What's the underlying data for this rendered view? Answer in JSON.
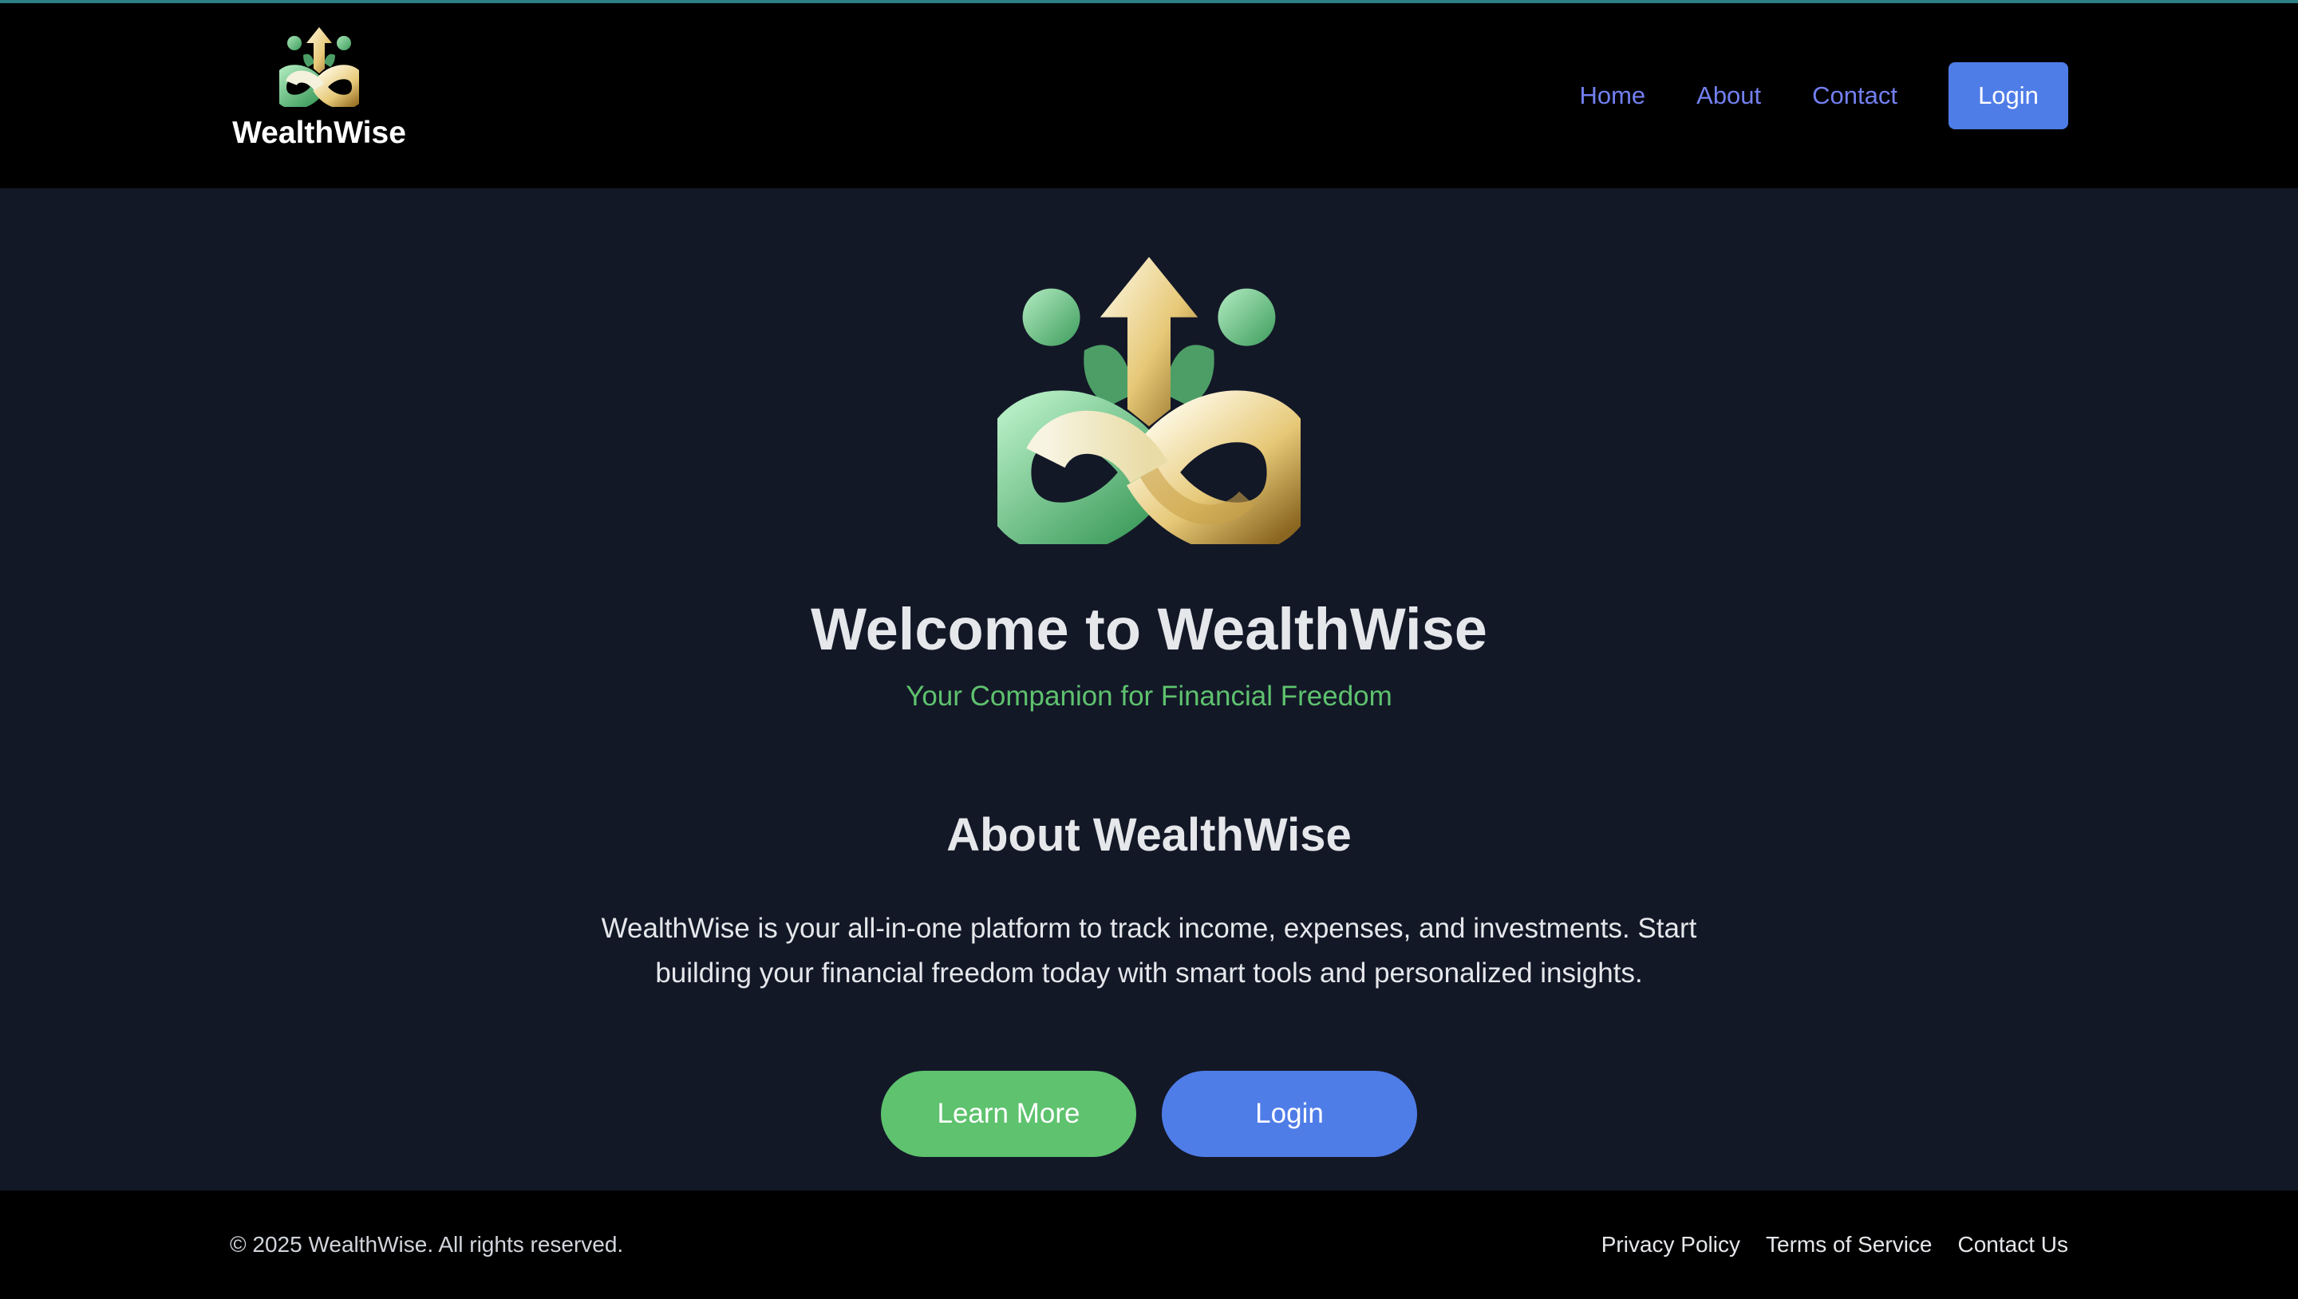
{
  "header": {
    "brand_name": "WealthWise",
    "nav": {
      "home": "Home",
      "about": "About",
      "contact": "Contact",
      "login": "Login"
    }
  },
  "hero": {
    "title": "Welcome to WealthWise",
    "subtitle": "Your Companion for Financial Freedom"
  },
  "about": {
    "title": "About WealthWise",
    "text": "WealthWise is your all-in-one platform to track income, expenses, and investments. Start building your financial freedom today with smart tools and personalized insights."
  },
  "cta": {
    "learn_more": "Learn More",
    "login": "Login"
  },
  "footer": {
    "copyright": "© 2025 WealthWise. All rights reserved.",
    "links": [
      "Privacy Policy",
      "Terms of Service",
      "Contact Us"
    ]
  },
  "colors": {
    "background": "#131827",
    "header_bg": "#000000",
    "accent_blue": "#4f7de8",
    "nav_link": "#7380f0",
    "accent_green": "#5ec26e",
    "text_light": "#e5e7eb"
  },
  "icons": {
    "brand_logo": "growth-infinity-arrow-logo",
    "hero_logo": "growth-infinity-arrow-logo"
  }
}
